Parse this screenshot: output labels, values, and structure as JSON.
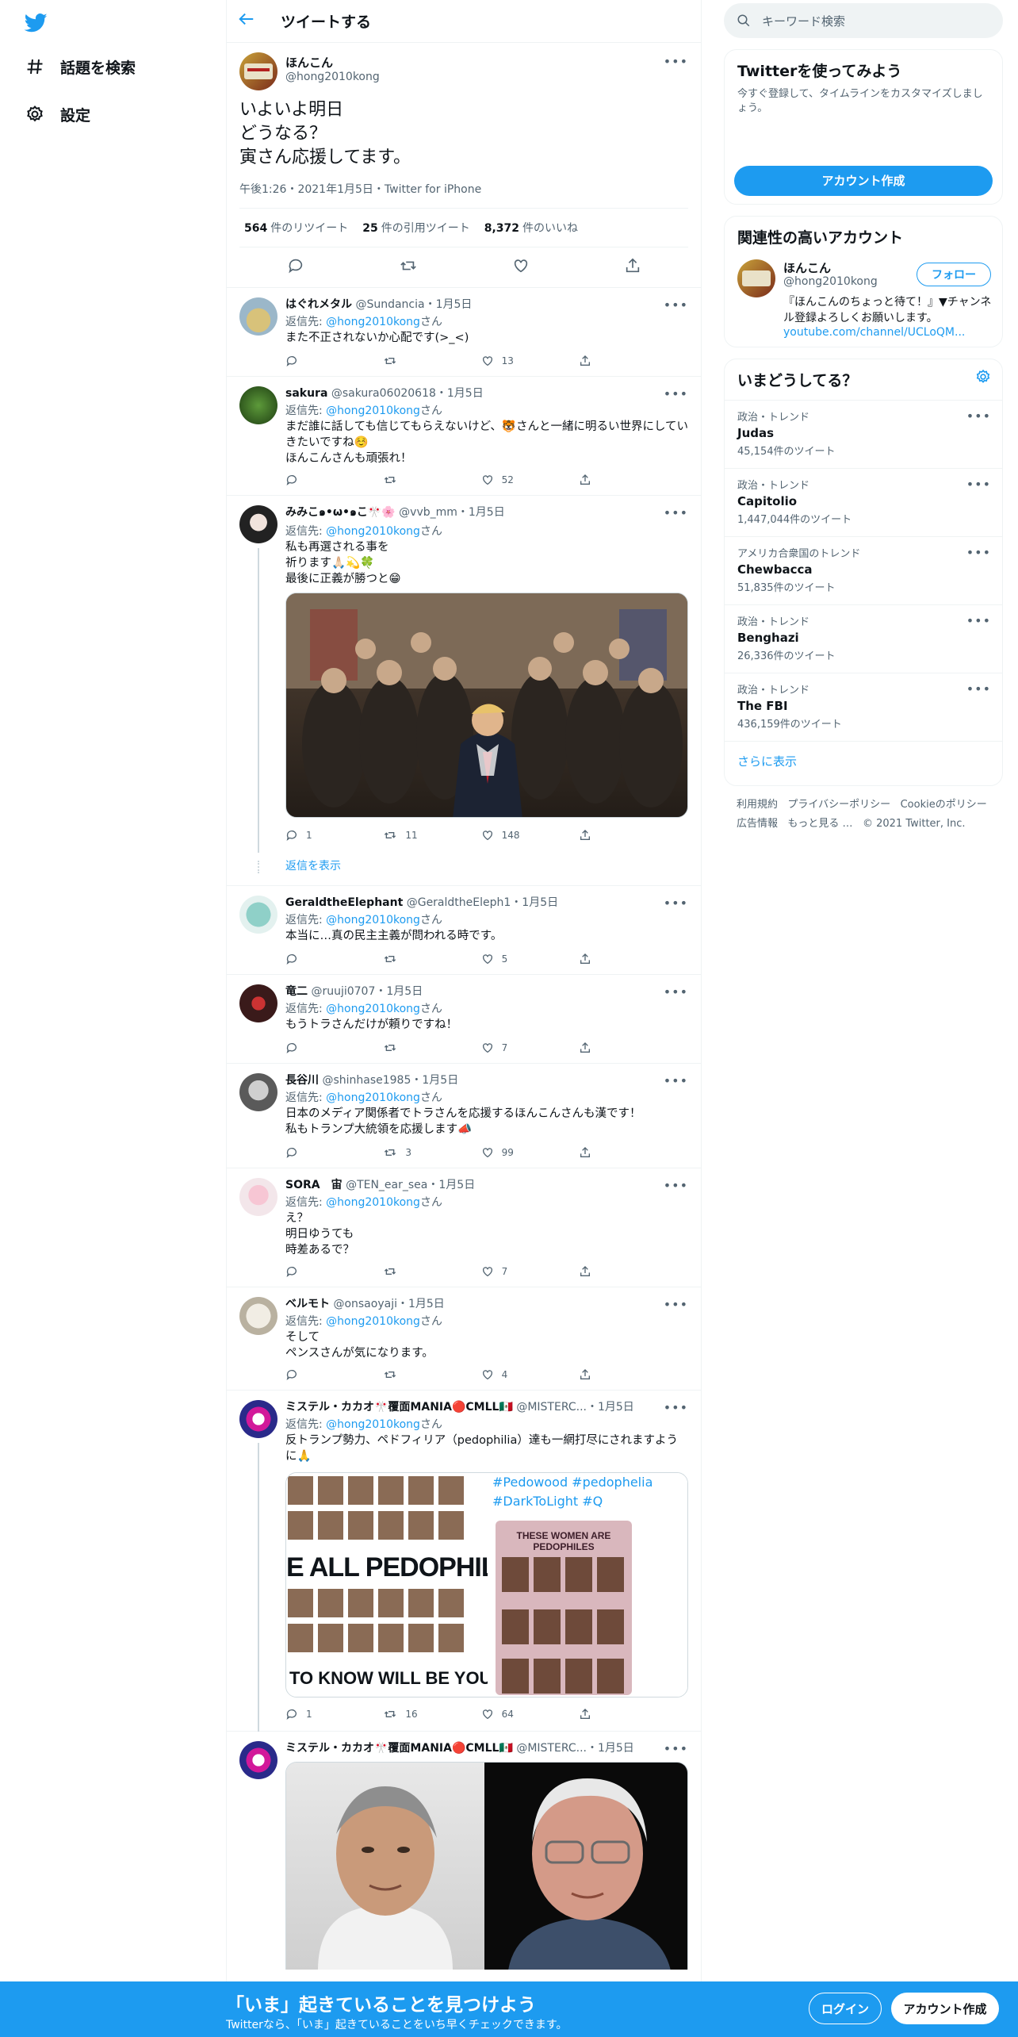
{
  "nav": {
    "explore_label": "話題を検索",
    "settings_label": "設定"
  },
  "header": {
    "title": "ツイートする"
  },
  "main_tweet": {
    "name": "ほんこん",
    "handle": "@hong2010kong",
    "text": "いよいよ明日\nどうなる？\n寅さん応援してます。",
    "meta": "午後1:26・2021年1月5日・Twitter for iPhone",
    "retweets_num": "564",
    "retweets_label": "件のリツイート",
    "quotes_num": "25",
    "quotes_label": "件の引用ツイート",
    "likes_num": "8,372",
    "likes_label": "件のいいね"
  },
  "replies": [
    {
      "name": "はぐれメタル",
      "handle": "@Sundancia",
      "date": "・1月5日",
      "reply_prefix": "返信先: ",
      "reply_to": "@hong2010kong",
      "reply_suffix": "さん",
      "text": "また不正されないか心配です(>_<)",
      "reply_count": "",
      "retweet_count": "",
      "like_count": "13"
    },
    {
      "name": "sakura",
      "handle": "@sakura06020618",
      "date": "・1月5日",
      "reply_prefix": "返信先: ",
      "reply_to": "@hong2010kong",
      "reply_suffix": "さん",
      "text": "まだ誰に話しても信じてもらえないけど、🐯さんと一緒に明るい世界にしていきたいですね☺️\nほんこんさんも頑張れ！",
      "reply_count": "",
      "retweet_count": "",
      "like_count": "52"
    },
    {
      "name": "みみこ๑•ω•๑こ🎌🌸",
      "handle": "@vvb_mm",
      "date": "・1月5日",
      "reply_prefix": "返信先: ",
      "reply_to": "@hong2010kong",
      "reply_suffix": "さん",
      "text": "私も再選される事を\n祈ります🙏🏻💫🍀\n最後に正義が勝つと😁",
      "reply_count": "1",
      "retweet_count": "11",
      "like_count": "148",
      "show_replies": "返信を表示"
    },
    {
      "name": "GeraldtheElephant",
      "handle": "@GeraldtheEleph1",
      "date": "・1月5日",
      "reply_prefix": "返信先: ",
      "reply_to": "@hong2010kong",
      "reply_suffix": "さん",
      "text": "本当に…真の民主主義が問われる時です。",
      "reply_count": "",
      "retweet_count": "",
      "like_count": "5"
    },
    {
      "name": "竜二",
      "handle": "@ruuji0707",
      "date": "・1月5日",
      "reply_prefix": "返信先: ",
      "reply_to": "@hong2010kong",
      "reply_suffix": "さん",
      "text": "もうトラさんだけが頼りですね！",
      "reply_count": "",
      "retweet_count": "",
      "like_count": "7"
    },
    {
      "name": "長谷川",
      "handle": "@shinhase1985",
      "date": "・1月5日",
      "reply_prefix": "返信先: ",
      "reply_to": "@hong2010kong",
      "reply_suffix": "さん",
      "text": "日本のメディア関係者でトラさんを応援するほんこんさんも漢です！\n私もトランプ大統領を応援します📣",
      "reply_count": "",
      "retweet_count": "3",
      "like_count": "99"
    },
    {
      "name": "SORA　宙",
      "handle": "@TEN_ear_sea",
      "date": "・1月5日",
      "reply_prefix": "返信先: ",
      "reply_to": "@hong2010kong",
      "reply_suffix": "さん",
      "text": "え？\n明日ゆうても\n時差あるで？",
      "reply_count": "",
      "retweet_count": "",
      "like_count": "7"
    },
    {
      "name": "ベルモト",
      "handle": "@onsaoyaji",
      "date": "・1月5日",
      "reply_prefix": "返信先: ",
      "reply_to": "@hong2010kong",
      "reply_suffix": "さん",
      "text": "そして\nペンスさんが気になります。",
      "reply_count": "",
      "retweet_count": "",
      "like_count": "4"
    },
    {
      "name": "ミステル・カカオ🎌覆面MANIA🔴CMLL🇲🇽",
      "handle": "@MISTERC...",
      "date": "・1月5日",
      "reply_prefix": "返信先: ",
      "reply_to": "@hong2010kong",
      "reply_suffix": "さん",
      "text": "反トランプ勢力、ペドフィリア（pedophilia）達も一網打尽にされますように🙏",
      "reply_count": "1",
      "retweet_count": "16",
      "like_count": "64"
    },
    {
      "name": "ミステル・カカオ🎌覆面MANIA🔴CMLL🇲🇽",
      "handle": "@MISTERC...",
      "date": "・1月5日"
    }
  ],
  "media_texts": {
    "pedo_left_main": "E ALL PEDOPHILES",
    "pedo_left_bottom": "TO KNOW WILL BE YOURS",
    "pedo_hashtags": "#Pedowood #pedophelia\n#DarkToLight #Q",
    "pedo_panel_title": "THESE WOMEN ARE PEDOPHILES"
  },
  "right": {
    "search_placeholder": "キーワード検索",
    "signup_box": {
      "title": "Twitterを使ってみよう",
      "desc": "今すぐ登録して、タイムラインをカスタマイズしましょう。",
      "button": "アカウント作成"
    },
    "related": {
      "title": "関連性の高いアカウント",
      "name": "ほんこん",
      "handle": "@hong2010kong",
      "follow": "フォロー",
      "bio": "『ほんこんのちょっと待て！』▼チャンネル登録よろしくお願いします。",
      "link": "youtube.com/channel/UCLoQM..."
    },
    "trends": {
      "title": "いまどうしてる？",
      "items": [
        {
          "cat": "政治・トレンド",
          "name": "Judas",
          "count": "45,154件のツイート"
        },
        {
          "cat": "政治・トレンド",
          "name": "Capitolio",
          "count": "1,447,044件のツイート"
        },
        {
          "cat": "アメリカ合衆国のトレンド",
          "name": "Chewbacca",
          "count": "51,835件のツイート"
        },
        {
          "cat": "政治・トレンド",
          "name": "Benghazi",
          "count": "26,336件のツイート"
        },
        {
          "cat": "政治・トレンド",
          "name": "The FBI",
          "count": "436,159件のツイート"
        }
      ],
      "show_more": "さらに表示"
    },
    "footer": {
      "terms": "利用規約",
      "privacy": "プライバシーポリシー",
      "cookie": "Cookieのポリシー",
      "ads": "広告情報",
      "more": "もっと見る …",
      "copyright": "© 2021 Twitter, Inc."
    }
  },
  "bottom_bar": {
    "title": "「いま」起きていることを見つけよう",
    "subtitle": "Twitterなら、「いま」起きていることをいち早くチェックできます。",
    "login": "ログイン",
    "signup": "アカウント作成"
  },
  "colors": {
    "accent": "#1d9bf0",
    "text": "#0f1419",
    "secondary": "#536471",
    "border": "#eff3f4"
  }
}
